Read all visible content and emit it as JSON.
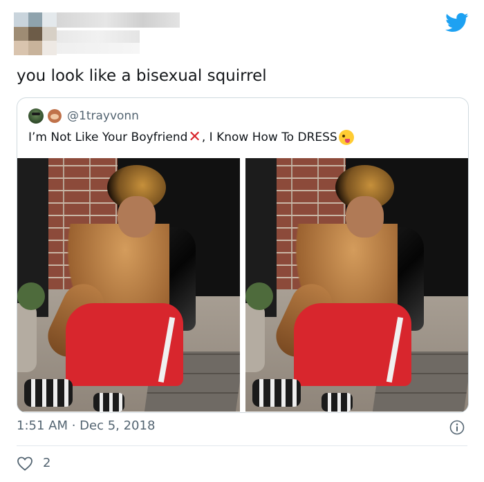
{
  "tweet": {
    "text": "you look like a bisexual squirrel",
    "timestamp": "1:51 AM · Dec 5, 2018",
    "like_count": "2"
  },
  "quoted_tweet": {
    "handle": "@1trayvonn",
    "text_part1": "I’m Not Like Your Boyfriend",
    "cross_mark": "✕",
    "text_part2": ", I Know How To DRESS"
  },
  "colors": {
    "twitter_blue": "#1da1f2",
    "muted_text": "#536471",
    "border": "#cfd9de",
    "cross_red": "#d8232a"
  },
  "icons": {
    "brand": "twitter-bird-icon",
    "info": "info-icon",
    "like": "heart-outline-icon"
  }
}
